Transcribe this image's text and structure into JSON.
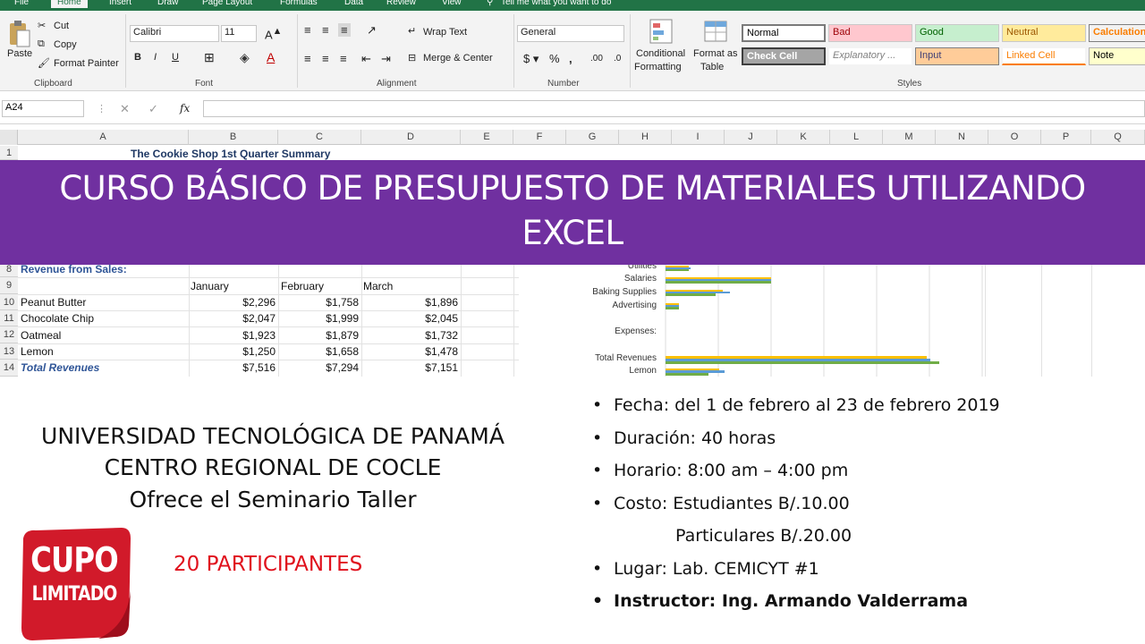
{
  "excel": {
    "tabs": [
      "File",
      "Home",
      "Insert",
      "Draw",
      "Page Layout",
      "Formulas",
      "Data",
      "Review",
      "View",
      "Tell me what you want to do"
    ],
    "clipboard": {
      "paste": "Paste",
      "cut": "Cut",
      "copy": "Copy",
      "format_painter": "Format Painter",
      "label": "Clipboard"
    },
    "font": {
      "name": "Calibri",
      "size": "11",
      "label": "Font"
    },
    "alignment": {
      "wrap": "Wrap Text",
      "merge": "Merge & Center",
      "label": "Alignment"
    },
    "number": {
      "format": "General",
      "label": "Number"
    },
    "styles": {
      "conditional": "Conditional",
      "formatting": "Formatting",
      "format_as": "Format as",
      "table": "Table",
      "label": "Styles",
      "boxes": [
        {
          "text": "Normal",
          "bg": "#ffffff",
          "color": "#000000"
        },
        {
          "text": "Bad",
          "bg": "#ffc7ce",
          "color": "#9c0006"
        },
        {
          "text": "Good",
          "bg": "#c6efce",
          "color": "#006100"
        },
        {
          "text": "Neutral",
          "bg": "#ffeb9c",
          "color": "#9c5700"
        },
        {
          "text": "Calculation",
          "bg": "#f2f2f2",
          "color": "#fa7d00"
        },
        {
          "text": "Check Cell",
          "bg": "#a5a5a5",
          "color": "#ffffff"
        },
        {
          "text": "Explanatory ...",
          "bg": "#ffffff",
          "color": "#7f7f7f"
        },
        {
          "text": "Input",
          "bg": "#ffcc99",
          "color": "#3f3f76"
        },
        {
          "text": "Linked Cell",
          "bg": "#ffffff",
          "color": "#fa7d00"
        },
        {
          "text": "Note",
          "bg": "#ffffcc",
          "color": "#000000"
        }
      ]
    },
    "name_box": "A24",
    "columns": [
      "A",
      "B",
      "C",
      "D",
      "E",
      "F",
      "G",
      "H",
      "I",
      "J",
      "K",
      "L",
      "M",
      "N",
      "O",
      "P",
      "Q"
    ],
    "rows": [
      "1",
      "8",
      "9",
      "10",
      "11",
      "12",
      "13",
      "14"
    ],
    "sheet_title": "The Cookie Shop 1st Quarter Summary",
    "revenue_label": "Revenue from Sales:",
    "months": [
      "January",
      "February",
      "March"
    ],
    "table": [
      {
        "name": "Peanut Butter",
        "values": [
          "$2,296",
          "$1,758",
          "$1,896"
        ]
      },
      {
        "name": "Chocolate Chip",
        "values": [
          "$2,047",
          "$1,999",
          "$2,045"
        ]
      },
      {
        "name": "Oatmeal",
        "values": [
          "$1,923",
          "$1,879",
          "$1,732"
        ]
      },
      {
        "name": "Lemon",
        "values": [
          "$1,250",
          "$1,658",
          "$1,478"
        ]
      },
      {
        "name": "Total Revenues",
        "values": [
          "$7,516",
          "$7,294",
          "$7,151"
        ]
      }
    ],
    "chart_labels": [
      "Utilities",
      "Salaries",
      "Baking Supplies",
      "Advertising",
      "Expenses:",
      "Total Revenues",
      "Lemon"
    ]
  },
  "banner": {
    "line1": "CURSO BÁSICO DE PRESUPUESTO DE MATERIALES UTILIZANDO",
    "line2": "EXCEL"
  },
  "org": {
    "line1": "UNIVERSIDAD TECNOLÓGICA DE PANAMÁ",
    "line2": "CENTRO REGIONAL DE COCLE",
    "line3": "Ofrece el Seminario Taller"
  },
  "badge": {
    "line1": "CUPO",
    "line2": "LIMITADO",
    "color": "#c8102e"
  },
  "participants": "20 PARTICIPANTES",
  "details": [
    "Fecha: del 1 de febrero al 23 de febrero 2019",
    "Duración: 40 horas",
    "Horario: 8:00 am – 4:00 pm",
    "Costo: Estudiantes B/.10.00",
    "Particulares B/.20.00",
    "Lugar: Lab. CEMICYT #1",
    "Instructor: Ing. Armando Valderrama"
  ]
}
